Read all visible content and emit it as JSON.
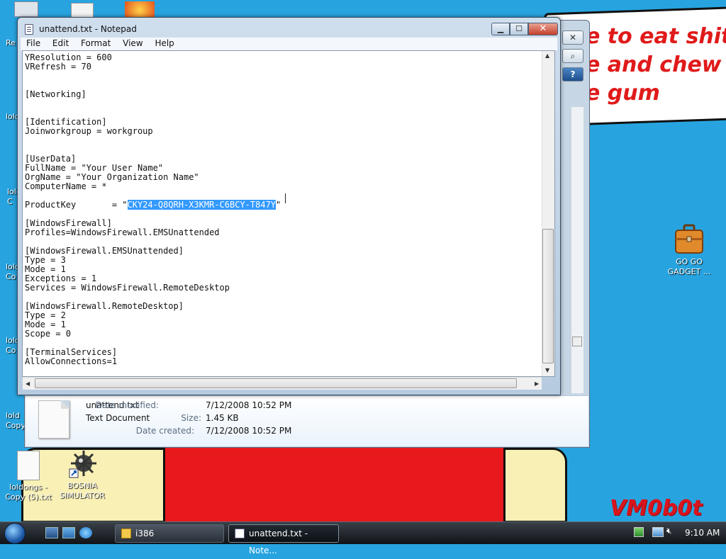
{
  "desktop": {
    "bubble_text": "e to eat shit\ne and chew\ne gum",
    "signature": "VM0b0t",
    "left_labels": [
      "Re",
      "lold",
      "lold\nC",
      "lold\nCo",
      "lold\nCo",
      "lold\nCopy"
    ],
    "icons": [
      {
        "label": "loldongs -\nCopy (5).txt",
        "icon": "text-file-icon"
      },
      {
        "label": "BOSNIA\nSIMULATOR",
        "icon": "minesweeper-shortcut-icon"
      },
      {
        "label": "GO GO\nGADGET ...",
        "icon": "briefcase-icon"
      }
    ]
  },
  "explorer": {
    "details": {
      "file_name": "unattend.txt",
      "file_type": "Text Document",
      "date_modified_label": "Date modified:",
      "date_modified": "7/12/2008 10:52 PM",
      "size_label": "Size:",
      "size": "1.45 KB",
      "date_created_label": "Date created:",
      "date_created": "7/12/2008 10:52 PM"
    },
    "buttons": {
      "close": "✕",
      "search": "⌕",
      "help": "?"
    }
  },
  "notepad": {
    "title": "unattend.txt - Notepad",
    "controls": {
      "minimize": "▁",
      "maximize": "☐",
      "close": "✕"
    },
    "menu": [
      "File",
      "Edit",
      "Format",
      "View",
      "Help"
    ],
    "content_before": "YResolution = 600\nVRefresh = 70\n\n\n[Networking]\n\n\n[Identification]\nJoinworkgroup = workgroup\n\n\n[UserData]\nFullName = \"Your User Name\"\nOrgName = \"Your Organization Name\"\nComputerName = *\n\nProductKey       = \"",
    "selected_text": "CKY24-Q8QRH-X3KMR-C6BCY-T847Y",
    "content_after": "\"\n\n[WindowsFirewall]\nProfiles=WindowsFirewall.EMSUnattended\n\n[WindowsFirewall.EMSUnattended]\nType = 3\nMode = 1\nExceptions = 1\nServices = WindowsFirewall.RemoteDesktop\n\n[WindowsFirewall.RemoteDesktop]\nType = 2\nMode = 1\nScope = 0\n\n[TerminalServices]\nAllowConnections=1"
  },
  "taskbar": {
    "tasks": [
      {
        "label": "i386",
        "icon": "folder-icon",
        "active": false
      },
      {
        "label": "unattend.txt - Note...",
        "icon": "notepad-icon",
        "active": true
      }
    ],
    "clock": "9:10 AM"
  },
  "colors": {
    "desktop_bg": "#27a4e0",
    "selection": "#3399ff",
    "bubble_text": "#e01a1a",
    "drawing_red": "#e8191c",
    "drawing_yellow": "#f8f0b4"
  }
}
